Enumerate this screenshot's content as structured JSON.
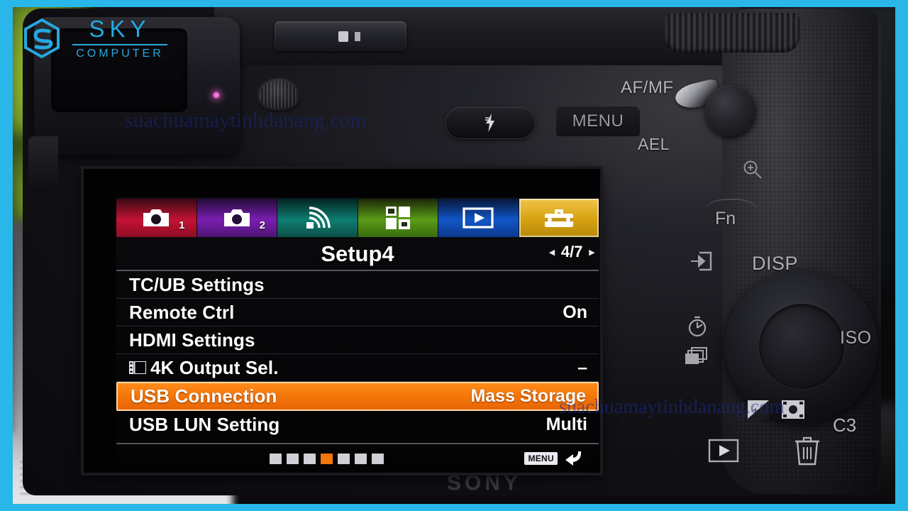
{
  "brand": {
    "logo_main": "SKY",
    "logo_sub": "COMPUTER",
    "logo_color": "#25a8e0",
    "mark_icon": "sky-s-hexagon-logo"
  },
  "watermarks": {
    "top": "suachuamaytinhdanang.com",
    "bottom": "suachuamaytinhdanang.com",
    "color": "#1b2a8c"
  },
  "camera": {
    "maker": "SONY",
    "buttons": {
      "flash": "flash-button",
      "menu": "MENU",
      "af_mf": "AF/MF",
      "ael": "AEL",
      "fn": "Fn",
      "disp": "DISP",
      "iso": "ISO",
      "c3": "C3",
      "magnify": "magnify-icon",
      "entry": "entry-icon",
      "timer": "self-timer-icon",
      "drive": "drive-mode-icon",
      "playback": "playback-icon",
      "trash": "trash-icon"
    }
  },
  "lcd": {
    "tabs": [
      {
        "name": "camera-settings-1",
        "icon": "camera-icon",
        "number": "1",
        "color": "#c41234",
        "active": false
      },
      {
        "name": "camera-settings-2",
        "icon": "camera-icon",
        "number": "2",
        "color": "#7a1fb0",
        "active": false
      },
      {
        "name": "network",
        "icon": "wifi-icon",
        "number": "",
        "color": "#0f7d72",
        "active": false
      },
      {
        "name": "playback-grid",
        "icon": "grid-icon",
        "number": "",
        "color": "#5a9c16",
        "active": false
      },
      {
        "name": "playback",
        "icon": "play-icon",
        "number": "",
        "color": "#1256c8",
        "active": false
      },
      {
        "name": "setup",
        "icon": "toolbox-icon",
        "number": "",
        "color": "#d9a514",
        "active": true
      }
    ],
    "title": "Setup4",
    "page_current": "4",
    "page_total": "7",
    "page_display": "4/7",
    "arrow_prev": "◂",
    "arrow_next": "▸",
    "items": [
      {
        "label": "TC/UB Settings",
        "value": "",
        "icon": "",
        "selected": false
      },
      {
        "label": "Remote Ctrl",
        "value": "On",
        "icon": "",
        "selected": false
      },
      {
        "label": "HDMI Settings",
        "value": "",
        "icon": "",
        "selected": false
      },
      {
        "label": "4K Output Sel.",
        "value": "–",
        "icon": "movie-icon",
        "selected": false
      },
      {
        "label": "USB Connection",
        "value": "Mass Storage",
        "icon": "",
        "selected": true
      },
      {
        "label": "USB LUN Setting",
        "value": "Multi",
        "icon": "",
        "selected": false
      }
    ],
    "footer": {
      "dot_count": 7,
      "dot_active_index": 3,
      "menu_chip": "MENU",
      "return_icon": "return-arrow-icon"
    },
    "highlight_color": "#f4760a"
  }
}
